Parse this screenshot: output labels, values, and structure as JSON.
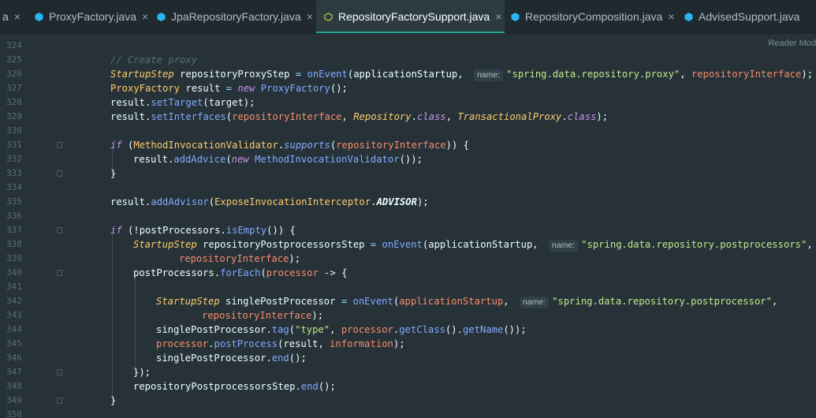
{
  "tabs": [
    {
      "label": "a",
      "icon": "",
      "active": false
    },
    {
      "label": "ProxyFactory.java",
      "icon": "java-class-icon",
      "active": false
    },
    {
      "label": "JpaRepositoryFactory.java",
      "icon": "java-class-icon",
      "active": false
    },
    {
      "label": "RepositoryFactorySupport.java",
      "icon": "java-file-icon",
      "active": true
    },
    {
      "label": "RepositoryComposition.java",
      "icon": "java-class-icon",
      "active": false
    },
    {
      "label": "AdvisedSupport.java",
      "icon": "java-class-icon",
      "active": false
    }
  ],
  "close_glyph": "×",
  "reader_mode": "Reader Mod",
  "hint_label": "name:",
  "colors": {
    "background": "#263238",
    "accent": "#26a69a",
    "keyword": "#c792ea",
    "type": "#ffcb6b",
    "method": "#82aaff",
    "string": "#c3e88d",
    "param": "#f78c6c",
    "comment": "#546e7a"
  },
  "lines": [
    {
      "num": "324"
    },
    {
      "num": "325",
      "c1": "// Create proxy"
    },
    {
      "num": "326",
      "c1": "StartupStep",
      "c2": " repositoryProxyStep ",
      "c3": "=",
      "c4": " onEvent",
      "c5": "(applicationStartup, ",
      "c6": "\"spring.data.repository.proxy\"",
      "c7": ", ",
      "c8": "repositoryInterface",
      "c9": ");"
    },
    {
      "num": "327",
      "c1": "ProxyFactory",
      "c2": " result ",
      "c3": "=",
      "c4": " new",
      "c5": " ProxyFactory",
      "c6": "();"
    },
    {
      "num": "328",
      "c1": "result.",
      "c2": "setTarget",
      "c3": "(target);"
    },
    {
      "num": "329",
      "c1": "result.",
      "c2": "setInterfaces",
      "c3": "(",
      "c4": "repositoryInterface",
      "c5": ", ",
      "c6": "Repository",
      "c7": ".",
      "c8": "class",
      "c9": ", ",
      "c10": "TransactionalProxy",
      "c11": ".",
      "c12": "class",
      "c13": ");"
    },
    {
      "num": "330"
    },
    {
      "num": "331",
      "c1": "if",
      "c2": " (",
      "c3": "MethodInvocationValidator",
      "c4": ".",
      "c5": "supports",
      "c6": "(",
      "c7": "repositoryInterface",
      "c8": ")) {"
    },
    {
      "num": "332",
      "c1": "result.",
      "c2": "addAdvice",
      "c3": "(",
      "c4": "new",
      "c5": " MethodInvocationValidator",
      "c6": "());"
    },
    {
      "num": "333",
      "c1": "}"
    },
    {
      "num": "334"
    },
    {
      "num": "335",
      "c1": "result.",
      "c2": "addAdvisor",
      "c3": "(",
      "c4": "ExposeInvocationInterceptor",
      "c5": ".",
      "c6": "ADVISOR",
      "c7": ");"
    },
    {
      "num": "336"
    },
    {
      "num": "337",
      "c1": "if",
      "c2": " (!postProcessors.",
      "c3": "isEmpty",
      "c4": "()) {"
    },
    {
      "num": "338",
      "c1": "StartupStep",
      "c2": " repositoryPostprocessorsStep ",
      "c3": "=",
      "c4": " onEvent",
      "c5": "(applicationStartup, ",
      "c6": "\"spring.data.repository.postprocessors\"",
      "c7": ","
    },
    {
      "num": "339",
      "c1": "repositoryInterface",
      "c2": ");"
    },
    {
      "num": "340",
      "c1": "postProcessors.",
      "c2": "forEach",
      "c3": "(",
      "c4": "processor",
      "c5": " -> {"
    },
    {
      "num": "341"
    },
    {
      "num": "342",
      "c1": "StartupStep",
      "c2": " singlePostProcessor ",
      "c3": "=",
      "c4": " onEvent",
      "c5": "(",
      "c6": "applicationStartup",
      "c7": ", ",
      "c8": "\"spring.data.repository.postprocessor\"",
      "c9": ","
    },
    {
      "num": "343",
      "c1": "repositoryInterface",
      "c2": ");"
    },
    {
      "num": "344",
      "c1": "singlePostProcessor.",
      "c2": "tag",
      "c3": "(",
      "c4": "\"type\"",
      "c5": ", ",
      "c6": "processor",
      "c7": ".",
      "c8": "getClass",
      "c9": "().",
      "c10": "getName",
      "c11": "());"
    },
    {
      "num": "345",
      "c1": "processor",
      "c2": ".",
      "c3": "postProcess",
      "c4": "(result, ",
      "c5": "information",
      "c6": ");"
    },
    {
      "num": "346",
      "c1": "singlePostProcessor.",
      "c2": "end",
      "c3": "();"
    },
    {
      "num": "347",
      "c1": "});"
    },
    {
      "num": "348",
      "c1": "repositoryPostprocessorsStep.",
      "c2": "end",
      "c3": "();"
    },
    {
      "num": "349",
      "c1": "}"
    },
    {
      "num": "350"
    }
  ]
}
